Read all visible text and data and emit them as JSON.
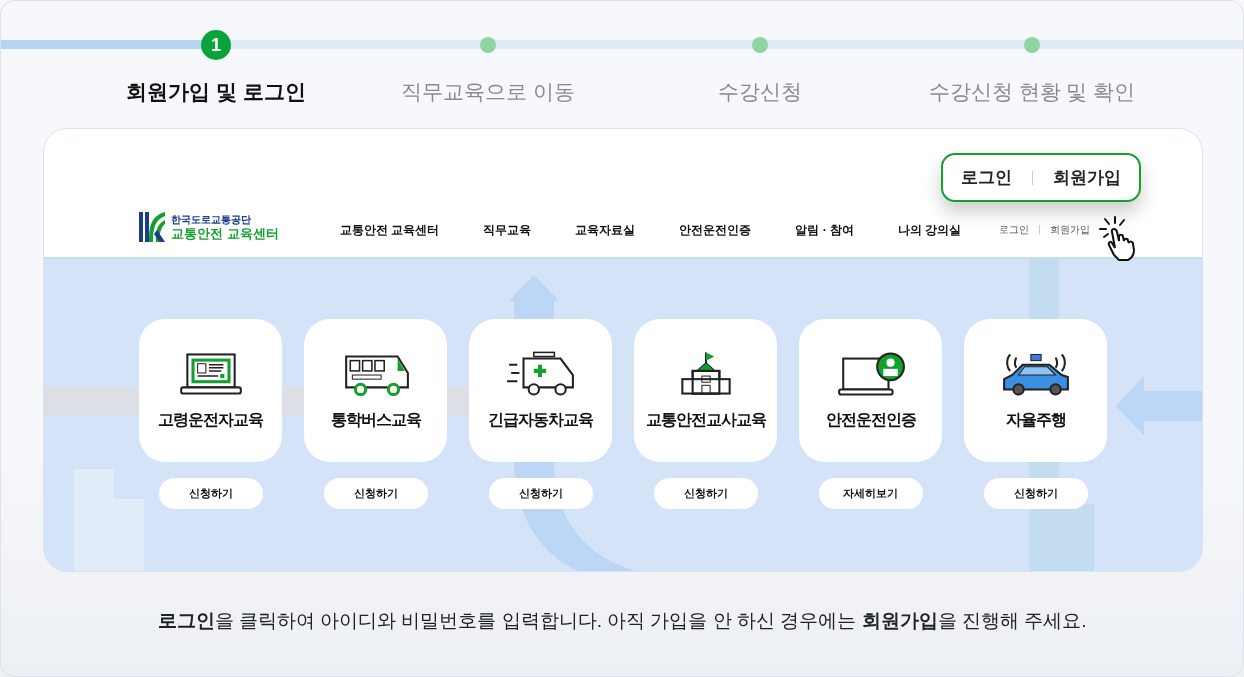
{
  "progress": {
    "level": 0.173
  },
  "steps": [
    {
      "number": "1",
      "label": "회원가입 및 로그인",
      "selected": true
    },
    {
      "label": "직무교육으로 이동",
      "selected": false
    },
    {
      "label": "수강신청",
      "selected": false
    },
    {
      "label": "수강신청 현황 및 확인",
      "selected": false
    }
  ],
  "site": {
    "logo": {
      "org": "한국도로교통공단",
      "name": "교통안전 교육센터"
    },
    "nav": [
      "교통안전 교육센터",
      "직무교육",
      "교육자료실",
      "안전운전인증",
      "알림 · 참여",
      "나의 강의실"
    ],
    "account_links": [
      "로그인",
      "회원가입"
    ],
    "callout_links": [
      "로그인",
      "회원가입"
    ],
    "courses": [
      {
        "title": "고령운전자교육",
        "action": "신청하기"
      },
      {
        "title": "통학버스교육",
        "action": "신청하기"
      },
      {
        "title": "긴급자동차교육",
        "action": "신청하기"
      },
      {
        "title": "교통안전교사교육",
        "action": "신청하기"
      },
      {
        "title": "안전운전인증",
        "action": "자세히보기"
      },
      {
        "title": "자율주행",
        "action": "신청하기"
      }
    ]
  },
  "caption": "**로그인**을 클릭하여 아이디와 비밀번호를 입력합니다. 아직 가입을 안 하신 경우에는 **회원가입**을 진행해 주세요."
}
